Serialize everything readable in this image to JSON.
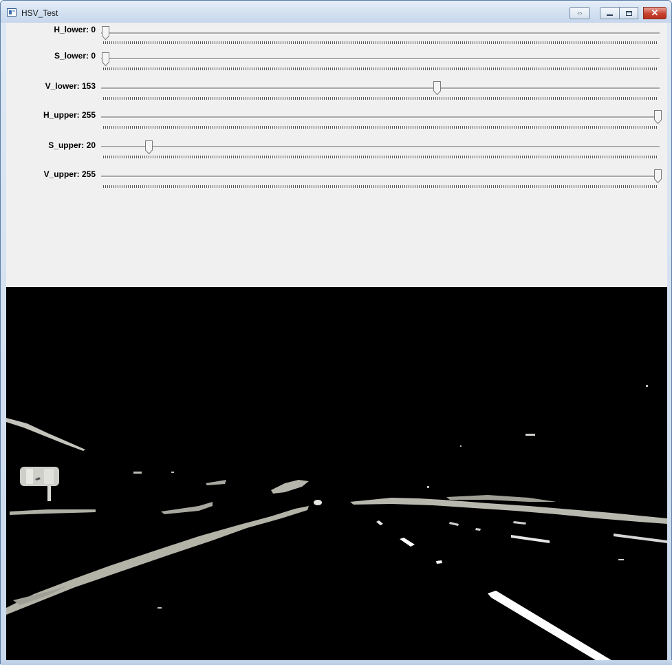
{
  "window": {
    "title": "HSV_Test",
    "buttons": {
      "extra": "⇔",
      "minimize": "",
      "maximize": "",
      "close": "✕"
    }
  },
  "trackbars": [
    {
      "name": "H_lower",
      "label": "H_lower: 0",
      "value": 0,
      "max": 255
    },
    {
      "name": "S_lower",
      "label": "S_lower: 0",
      "value": 0,
      "max": 255
    },
    {
      "name": "V_lower",
      "label": "V_lower: 153",
      "value": 153,
      "max": 255
    },
    {
      "name": "H_upper",
      "label": "H_upper: 255",
      "value": 255,
      "max": 255
    },
    {
      "name": "S_upper",
      "label": "S_upper: 20",
      "value": 20,
      "max": 255
    },
    {
      "name": "V_upper",
      "label": "V_upper: 255",
      "value": 255,
      "max": 255
    }
  ],
  "preview": {
    "description_colors": {
      "background": "#000000",
      "mask": "#b8b8ae",
      "lane": "#ffffff"
    }
  }
}
